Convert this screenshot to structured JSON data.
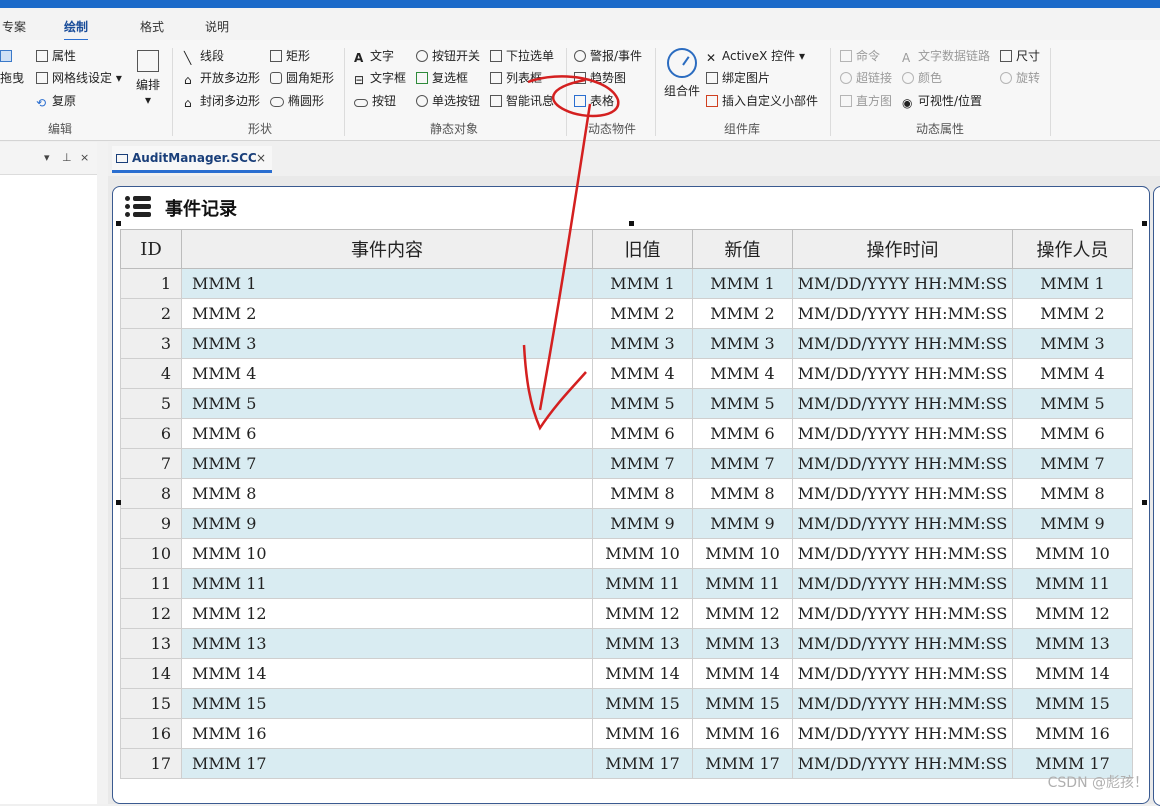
{
  "tabs": [
    "专案",
    "绘制",
    "格式",
    "说明"
  ],
  "active_tab": "绘制",
  "ribbon": {
    "edit": {
      "label": "编辑",
      "items": [
        "属性",
        "网格线设定",
        "复原",
        "拖曳"
      ],
      "big": "编排"
    },
    "shapes": {
      "label": "形状",
      "items": [
        "线段",
        "矩形",
        "开放多边形",
        "圆角矩形",
        "封闭多边形",
        "椭圆形"
      ]
    },
    "static": {
      "label": "静态对象",
      "items": [
        "文字",
        "按钮开关",
        "下拉选单",
        "文字框",
        "复选框",
        "列表框",
        "按钮",
        "单选按钮",
        "智能讯息"
      ]
    },
    "dynamic": {
      "label": "动态物件",
      "items": [
        "警报/事件",
        "趋势图",
        "表格"
      ]
    },
    "components": {
      "label": "组件库",
      "big": "组合件",
      "items": [
        "ActiveX 控件",
        "绑定图片",
        "插入自定义小部件"
      ]
    },
    "dynprops": {
      "label": "动态属性",
      "items": [
        "命令",
        "文字数据链路",
        "尺寸",
        "超链接",
        "颜色",
        "旋转",
        "直方图",
        "可视性/位置"
      ]
    }
  },
  "doc_tab": {
    "title": "AuditManager.SCC",
    "close": "×"
  },
  "panel_controls": {
    "dropdown": "▾",
    "pin": "⊥",
    "close": "×"
  },
  "frame": {
    "title": "事件记录"
  },
  "table": {
    "headers": [
      "ID",
      "事件内容",
      "旧值",
      "新值",
      "操作时间",
      "操作人员"
    ],
    "rows": [
      [
        "1",
        "MMM 1",
        "MMM 1",
        "MMM 1",
        "MM/DD/YYYY HH:MM:SS",
        "MMM 1"
      ],
      [
        "2",
        "MMM 2",
        "MMM 2",
        "MMM 2",
        "MM/DD/YYYY HH:MM:SS",
        "MMM 2"
      ],
      [
        "3",
        "MMM 3",
        "MMM 3",
        "MMM 3",
        "MM/DD/YYYY HH:MM:SS",
        "MMM 3"
      ],
      [
        "4",
        "MMM 4",
        "MMM 4",
        "MMM 4",
        "MM/DD/YYYY HH:MM:SS",
        "MMM 4"
      ],
      [
        "5",
        "MMM 5",
        "MMM 5",
        "MMM 5",
        "MM/DD/YYYY HH:MM:SS",
        "MMM 5"
      ],
      [
        "6",
        "MMM 6",
        "MMM 6",
        "MMM 6",
        "MM/DD/YYYY HH:MM:SS",
        "MMM 6"
      ],
      [
        "7",
        "MMM 7",
        "MMM 7",
        "MMM 7",
        "MM/DD/YYYY HH:MM:SS",
        "MMM 7"
      ],
      [
        "8",
        "MMM 8",
        "MMM 8",
        "MMM 8",
        "MM/DD/YYYY HH:MM:SS",
        "MMM 8"
      ],
      [
        "9",
        "MMM 9",
        "MMM 9",
        "MMM 9",
        "MM/DD/YYYY HH:MM:SS",
        "MMM 9"
      ],
      [
        "10",
        "MMM 10",
        "MMM 10",
        "MMM 10",
        "MM/DD/YYYY HH:MM:SS",
        "MMM 10"
      ],
      [
        "11",
        "MMM 11",
        "MMM 11",
        "MMM 11",
        "MM/DD/YYYY HH:MM:SS",
        "MMM 11"
      ],
      [
        "12",
        "MMM 12",
        "MMM 12",
        "MMM 12",
        "MM/DD/YYYY HH:MM:SS",
        "MMM 12"
      ],
      [
        "13",
        "MMM 13",
        "MMM 13",
        "MMM 13",
        "MM/DD/YYYY HH:MM:SS",
        "MMM 13"
      ],
      [
        "14",
        "MMM 14",
        "MMM 14",
        "MMM 14",
        "MM/DD/YYYY HH:MM:SS",
        "MMM 14"
      ],
      [
        "15",
        "MMM 15",
        "MMM 15",
        "MMM 15",
        "MM/DD/YYYY HH:MM:SS",
        "MMM 15"
      ],
      [
        "16",
        "MMM 16",
        "MMM 16",
        "MMM 16",
        "MM/DD/YYYY HH:MM:SS",
        "MMM 16"
      ],
      [
        "17",
        "MMM 17",
        "MMM 17",
        "MMM 17",
        "MM/DD/YYYY HH:MM:SS",
        "MMM 17"
      ]
    ]
  },
  "watermark": "CSDN @彪孩！",
  "colors": {
    "accent": "#1b6ac9",
    "row_alt": "#d9ecf2",
    "annotation": "#d42020"
  }
}
